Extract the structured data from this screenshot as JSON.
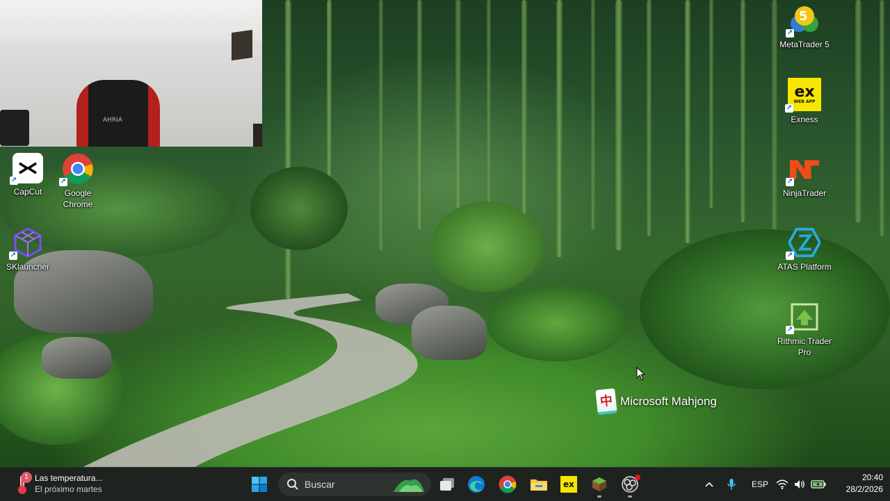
{
  "desktop_icons": [
    {
      "label": "CapCut",
      "icon": "capcut-icon"
    },
    {
      "label": "Google Chrome",
      "icon": "chrome-icon"
    },
    {
      "label": "SKlauncher",
      "icon": "sklauncher-icon"
    },
    {
      "label": "MetaTrader 5",
      "icon": "metatrader-icon",
      "badge": "5"
    },
    {
      "label": "Exness",
      "icon": "exness-icon",
      "tile_text": "ex",
      "tile_subtext": "WEB APP"
    },
    {
      "label": "NinjaTrader",
      "icon": "ninjatrader-icon"
    },
    {
      "label": "ATAS Platform",
      "icon": "atas-icon"
    },
    {
      "label": "Rithmic Trader Pro",
      "icon": "rithmic-icon"
    }
  ],
  "mahjong": {
    "label": "Microsoft Mahjong",
    "icon": "mahjong-icon",
    "glyph": "中"
  },
  "webcam": {
    "chair_brand": "AHRIA"
  },
  "taskbar": {
    "widget": {
      "title": "Las temperatura...",
      "subtitle": "El próximo martes",
      "badge": "1"
    },
    "search_placeholder": "Buscar",
    "pinned": [
      {
        "name": "start-button",
        "icon": "windows-icon"
      },
      {
        "name": "task-view-button",
        "icon": "task-view-icon"
      },
      {
        "name": "edge-button",
        "icon": "edge-icon"
      },
      {
        "name": "chrome-taskbar-button",
        "icon": "chrome-icon"
      },
      {
        "name": "file-explorer-button",
        "icon": "folder-icon"
      },
      {
        "name": "exness-taskbar-button",
        "icon": "exness-icon",
        "tile_text": "ex"
      },
      {
        "name": "minecraft-button",
        "icon": "minecraft-icon"
      },
      {
        "name": "obs-button",
        "icon": "obs-icon"
      }
    ],
    "tray": {
      "language": "ESP",
      "time": "20:40",
      "date": "28/2/2026"
    }
  },
  "colors": {
    "taskbar_bg": "#1f2320",
    "accent": "#0a7bd8",
    "exness_yellow": "#f7e600",
    "ninja_orange": "#f24b1a",
    "atas_blue": "#29a9e1"
  }
}
